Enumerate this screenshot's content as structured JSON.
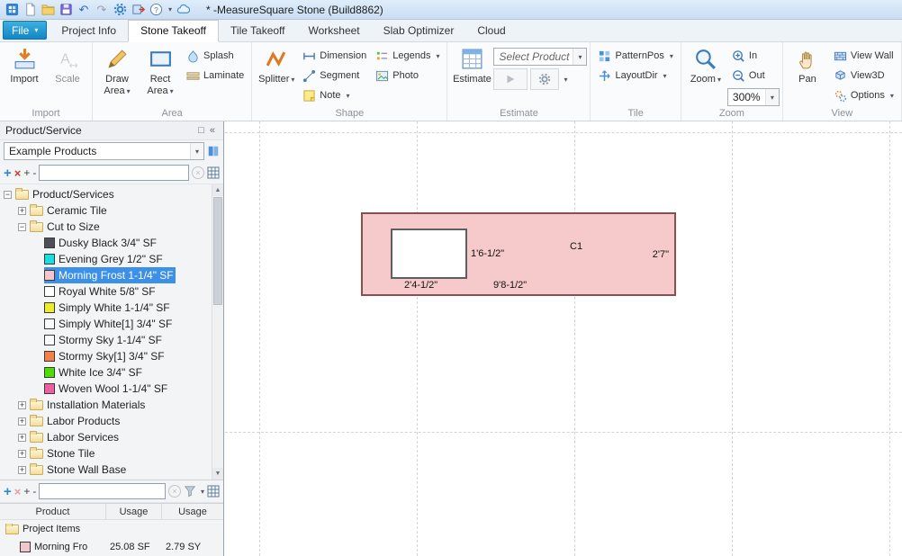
{
  "titlebar": {
    "title": "* -MeasureSquare Stone (Build8862)"
  },
  "menu": {
    "file": "File",
    "tabs": [
      "Project Info",
      "Stone Takeoff",
      "Tile Takeoff",
      "Worksheet",
      "Slab Optimizer",
      "Cloud"
    ],
    "active_tab": "Stone Takeoff"
  },
  "ribbon": {
    "import_group": {
      "label": "Import",
      "import": "Import",
      "scale": "Scale"
    },
    "area_group": {
      "label": "Area",
      "draw_area": "Draw Area",
      "rect_area": "Rect Area",
      "splash": "Splash",
      "laminate": "Laminate"
    },
    "shape_group": {
      "label": "Shape",
      "splitter": "Splitter",
      "dimension": "Dimension",
      "segment": "Segment",
      "note": "Note",
      "legends": "Legends",
      "photo": "Photo"
    },
    "estimate_group": {
      "label": "Estimate",
      "estimate": "Estimate",
      "select_product": "Select Product"
    },
    "tile_group": {
      "label": "Tile",
      "patternpos": "PatternPos",
      "layoutdir": "LayoutDir"
    },
    "zoom_group": {
      "label": "Zoom",
      "zoom": "Zoom",
      "zoom_in": "In",
      "zoom_out": "Out",
      "zoom_level": "300%"
    },
    "view_group": {
      "label": "View",
      "pan": "Pan",
      "view_wall": "View Wall",
      "view3d": "View3D",
      "options": "Options"
    }
  },
  "product_panel": {
    "title": "Product/Service",
    "combo_value": "Example Products",
    "tree": [
      {
        "type": "folder",
        "level": 0,
        "expander": "minus",
        "label": "Product/Services"
      },
      {
        "type": "folder",
        "level": 1,
        "expander": "plus",
        "label": "Ceramic Tile"
      },
      {
        "type": "folder",
        "level": 1,
        "expander": "minus",
        "label": "Cut to Size"
      },
      {
        "type": "product",
        "level": 2,
        "swatch": "#4e4e58",
        "label": "Dusky Black  3/4\" SF"
      },
      {
        "type": "product",
        "level": 2,
        "swatch": "#17dfe0",
        "label": "Evening Grey  1/2\" SF"
      },
      {
        "type": "product",
        "level": 2,
        "swatch": "#f4c6cb",
        "label": "Morning Frost  1-1/4\" SF",
        "selected": true
      },
      {
        "type": "product",
        "level": 2,
        "swatch": "#ffffff",
        "label": "Royal White  5/8\" SF"
      },
      {
        "type": "product",
        "level": 2,
        "swatch": "#ecec28",
        "label": "Simply White  1-1/4\" SF"
      },
      {
        "type": "product",
        "level": 2,
        "swatch": "#ffffff",
        "label": "Simply White[1]  3/4\" SF"
      },
      {
        "type": "product",
        "level": 2,
        "swatch": "#fbfbfb",
        "label": "Stormy Sky  1-1/4\" SF"
      },
      {
        "type": "product",
        "level": 2,
        "swatch": "#f28048",
        "label": "Stormy Sky[1]  3/4\" SF"
      },
      {
        "type": "product",
        "level": 2,
        "swatch": "#4fdc00",
        "label": "White Ice  3/4\" SF"
      },
      {
        "type": "product",
        "level": 2,
        "swatch": "#ef5fa0",
        "label": "Woven Wool  1-1/4\" SF"
      },
      {
        "type": "folder",
        "level": 1,
        "expander": "plus",
        "label": "Installation Materials"
      },
      {
        "type": "folder",
        "level": 1,
        "expander": "plus",
        "label": "Labor Products"
      },
      {
        "type": "folder",
        "level": 1,
        "expander": "plus",
        "label": "Labor Services"
      },
      {
        "type": "folder",
        "level": 1,
        "expander": "plus",
        "label": "Stone Tile"
      },
      {
        "type": "folder",
        "level": 1,
        "expander": "plus",
        "label": "Stone Wall Base"
      }
    ]
  },
  "usage_panel": {
    "columns": [
      "Product",
      "Usage",
      "Usage"
    ],
    "tree": [
      {
        "type": "folder",
        "level": 0,
        "expander": "none",
        "label": "Project Items"
      },
      {
        "type": "product",
        "level": 1,
        "swatch": "#f4c6cb",
        "label": "Morning Fro",
        "usage1": "25.08 SF",
        "usage2": "2.79 SY"
      }
    ]
  },
  "canvas": {
    "room": {
      "fill_color": "#f6caca",
      "border_color": "#8a4f4f",
      "labels": {
        "hole_height": "1'6-1/2\"",
        "area_code": "C1",
        "right_height": "2'7\"",
        "hole_width": "2'4-1/2\"",
        "bottom_width": "9'8-1/2\""
      }
    }
  }
}
